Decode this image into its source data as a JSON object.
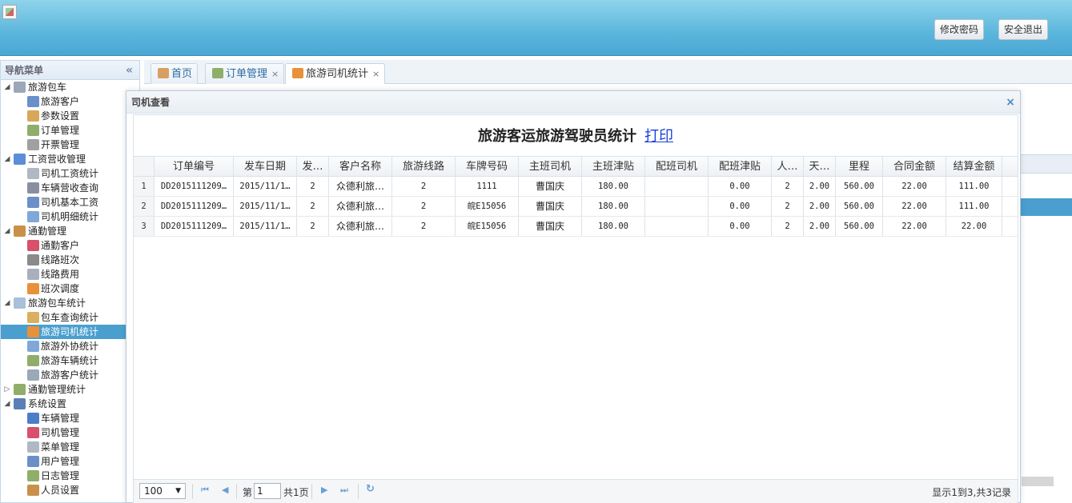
{
  "header": {
    "change_password": "修改密码",
    "logout": "安全退出"
  },
  "nav": {
    "title": "导航菜单",
    "collapse": "«",
    "tree": [
      {
        "level": 0,
        "toggle": "◢",
        "label": "旅游包车",
        "icon_color": "#9aa8b8"
      },
      {
        "level": 1,
        "label": "旅游客户",
        "icon_color": "#6b8fc9"
      },
      {
        "level": 1,
        "label": "参数设置",
        "icon_color": "#d8a85a"
      },
      {
        "level": 1,
        "label": "订单管理",
        "icon_color": "#8fae6a"
      },
      {
        "level": 1,
        "label": "开票管理",
        "icon_color": "#a0a0a0"
      },
      {
        "level": 0,
        "toggle": "◢",
        "label": "工资营收管理",
        "icon_color": "#5a8fd8"
      },
      {
        "level": 1,
        "label": "司机工资统计",
        "icon_color": "#b0b8c4"
      },
      {
        "level": 1,
        "label": "车辆营收查询",
        "icon_color": "#8890a0"
      },
      {
        "level": 1,
        "label": "司机基本工资",
        "icon_color": "#6b8fc9"
      },
      {
        "level": 1,
        "label": "司机明细统计",
        "icon_color": "#7fa8d8"
      },
      {
        "level": 0,
        "toggle": "◢",
        "label": "通勤管理",
        "icon_color": "#c9904a"
      },
      {
        "level": 1,
        "label": "通勤客户",
        "icon_color": "#d8506a"
      },
      {
        "level": 1,
        "label": "线路班次",
        "icon_color": "#8a8a8a"
      },
      {
        "level": 1,
        "label": "线路费用",
        "icon_color": "#a8b0bc"
      },
      {
        "level": 1,
        "label": "班次调度",
        "icon_color": "#e8903a"
      },
      {
        "level": 0,
        "toggle": "◢",
        "label": "旅游包车统计",
        "icon_color": "#a8c0d8"
      },
      {
        "level": 1,
        "label": "包车查询统计",
        "icon_color": "#d8b060"
      },
      {
        "level": 1,
        "label": "旅游司机统计",
        "icon_color": "#e8903a",
        "selected": true
      },
      {
        "level": 1,
        "label": "旅游外协统计",
        "icon_color": "#7fa8d8"
      },
      {
        "level": 1,
        "label": "旅游车辆统计",
        "icon_color": "#8fae6a"
      },
      {
        "level": 1,
        "label": "旅游客户统计",
        "icon_color": "#9aa8b8"
      },
      {
        "level": 0,
        "toggle": "▷",
        "label": "通勤管理统计",
        "icon_color": "#8fae6a"
      },
      {
        "level": 0,
        "toggle": "◢",
        "label": "系统设置",
        "icon_color": "#5a7fb8"
      },
      {
        "level": 1,
        "label": "车辆管理",
        "icon_color": "#4a7fc8"
      },
      {
        "level": 1,
        "label": "司机管理",
        "icon_color": "#d8506a"
      },
      {
        "level": 1,
        "label": "菜单管理",
        "icon_color": "#b0b8c4"
      },
      {
        "level": 1,
        "label": "用户管理",
        "icon_color": "#6b8fc9"
      },
      {
        "level": 1,
        "label": "日志管理",
        "icon_color": "#8fae6a"
      },
      {
        "level": 1,
        "label": "人员设置",
        "icon_color": "#c9904a"
      }
    ]
  },
  "tabs": [
    {
      "label": "首页",
      "closable": false,
      "icon_color": "#d8a060"
    },
    {
      "label": "订单管理",
      "closable": true,
      "icon_color": "#8fae6a"
    },
    {
      "label": "旅游司机统计",
      "closable": true,
      "icon_color": "#e8903a",
      "active": true
    }
  ],
  "tab_close": "×",
  "dialog": {
    "title": "司机查看",
    "close": "×",
    "report_title": "旅游客运旅游驾驶员统计",
    "print_link": "打印"
  },
  "grid": {
    "columns": [
      "",
      "订单编号",
      "发车日期",
      "发…",
      "客户名称",
      "旅游线路",
      "车牌号码",
      "主班司机",
      "主班津贴",
      "配班司机",
      "配班津贴",
      "人…",
      "天…",
      "里程",
      "合同金额",
      "结算金额"
    ],
    "rows": [
      [
        "1",
        "DD2015111209…",
        "2015/11/1…",
        "2",
        "众德利旅…",
        "2",
        "1111",
        "曹国庆",
        "180.00",
        "",
        "0.00",
        "2",
        "2.00",
        "560.00",
        "22.00",
        "111.00"
      ],
      [
        "2",
        "DD2015111209…",
        "2015/11/1…",
        "2",
        "众德利旅…",
        "2",
        "皖E15056",
        "曹国庆",
        "180.00",
        "",
        "0.00",
        "2",
        "2.00",
        "560.00",
        "22.00",
        "111.00"
      ],
      [
        "3",
        "DD2015111209…",
        "2015/11/1…",
        "2",
        "众德利旅…",
        "2",
        "皖E15056",
        "曹国庆",
        "180.00",
        "",
        "0.00",
        "2",
        "2.00",
        "560.00",
        "22.00",
        "22.00"
      ]
    ]
  },
  "pager": {
    "page_size": "100",
    "first": "⏮",
    "prev": "◀",
    "page_prefix": "第",
    "page_value": "1",
    "page_suffix": "共1页",
    "next": "▶",
    "last": "⏭",
    "refresh": "↻",
    "info": "显示1到3,共3记录"
  }
}
